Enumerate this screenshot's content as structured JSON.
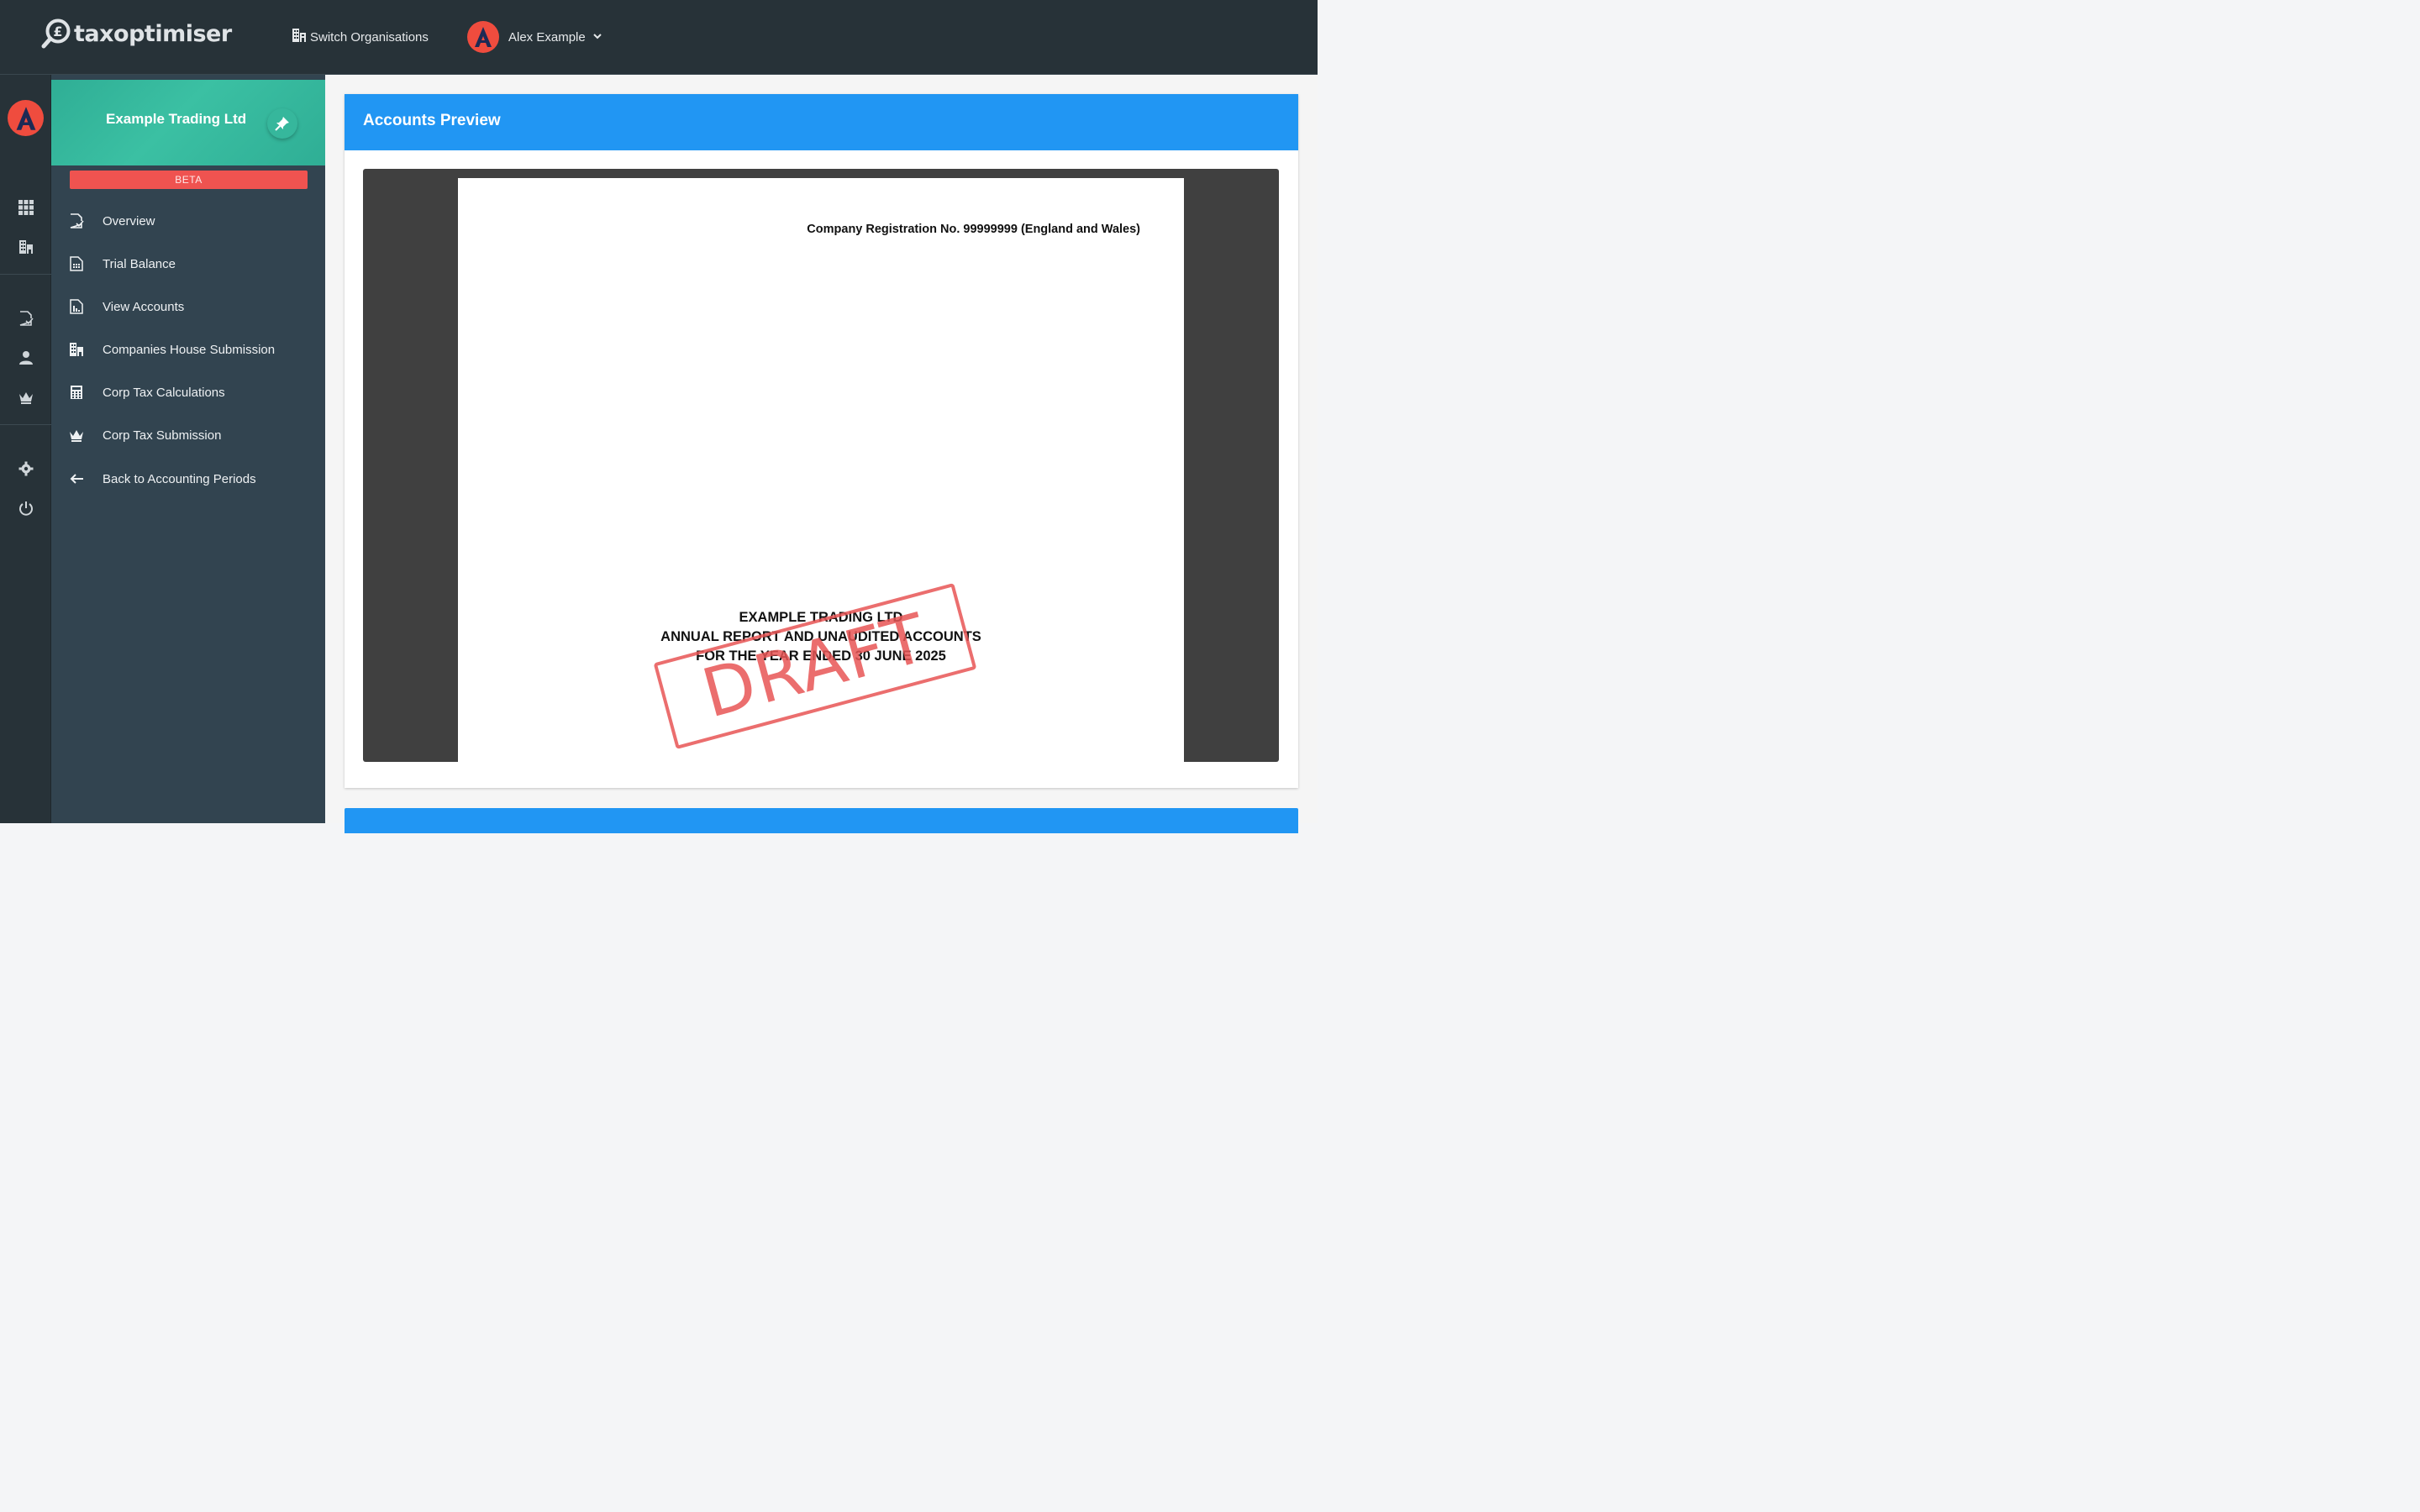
{
  "brand": {
    "name": "taxoptimiser"
  },
  "topbar": {
    "switch_org_label": "Switch Organisations",
    "user_name": "Alex Example"
  },
  "sidebar": {
    "org_name": "Example Trading Ltd",
    "beta_label": "BETA",
    "items": [
      {
        "label": "Overview",
        "icon": "document-check-icon"
      },
      {
        "label": "Trial Balance",
        "icon": "spreadsheet-icon"
      },
      {
        "label": "View Accounts",
        "icon": "report-chart-icon"
      },
      {
        "label": "Companies House Submission",
        "icon": "building-icon"
      },
      {
        "label": "Corp Tax Calculations",
        "icon": "calculator-icon"
      },
      {
        "label": "Corp Tax Submission",
        "icon": "crown-icon"
      },
      {
        "label": "Back to Accounting Periods",
        "icon": "arrow-left-icon"
      }
    ]
  },
  "main": {
    "card_title": "Accounts Preview",
    "document": {
      "registration": "Company Registration No. 99999999 (England and Wales)",
      "title_lines": [
        "EXAMPLE TRADING LTD",
        "ANNUAL REPORT AND UNAUDITED ACCOUNTS",
        "FOR THE YEAR ENDED 30 JUNE 2025"
      ],
      "watermark": "DRAFT"
    }
  },
  "colors": {
    "topbar": "#273238",
    "sidebar": "#324450",
    "org_header": "#33b89c",
    "beta": "#ef5350",
    "accent": "#2196f3",
    "avatar": "#ef4c3e",
    "watermark": "#e85555"
  }
}
